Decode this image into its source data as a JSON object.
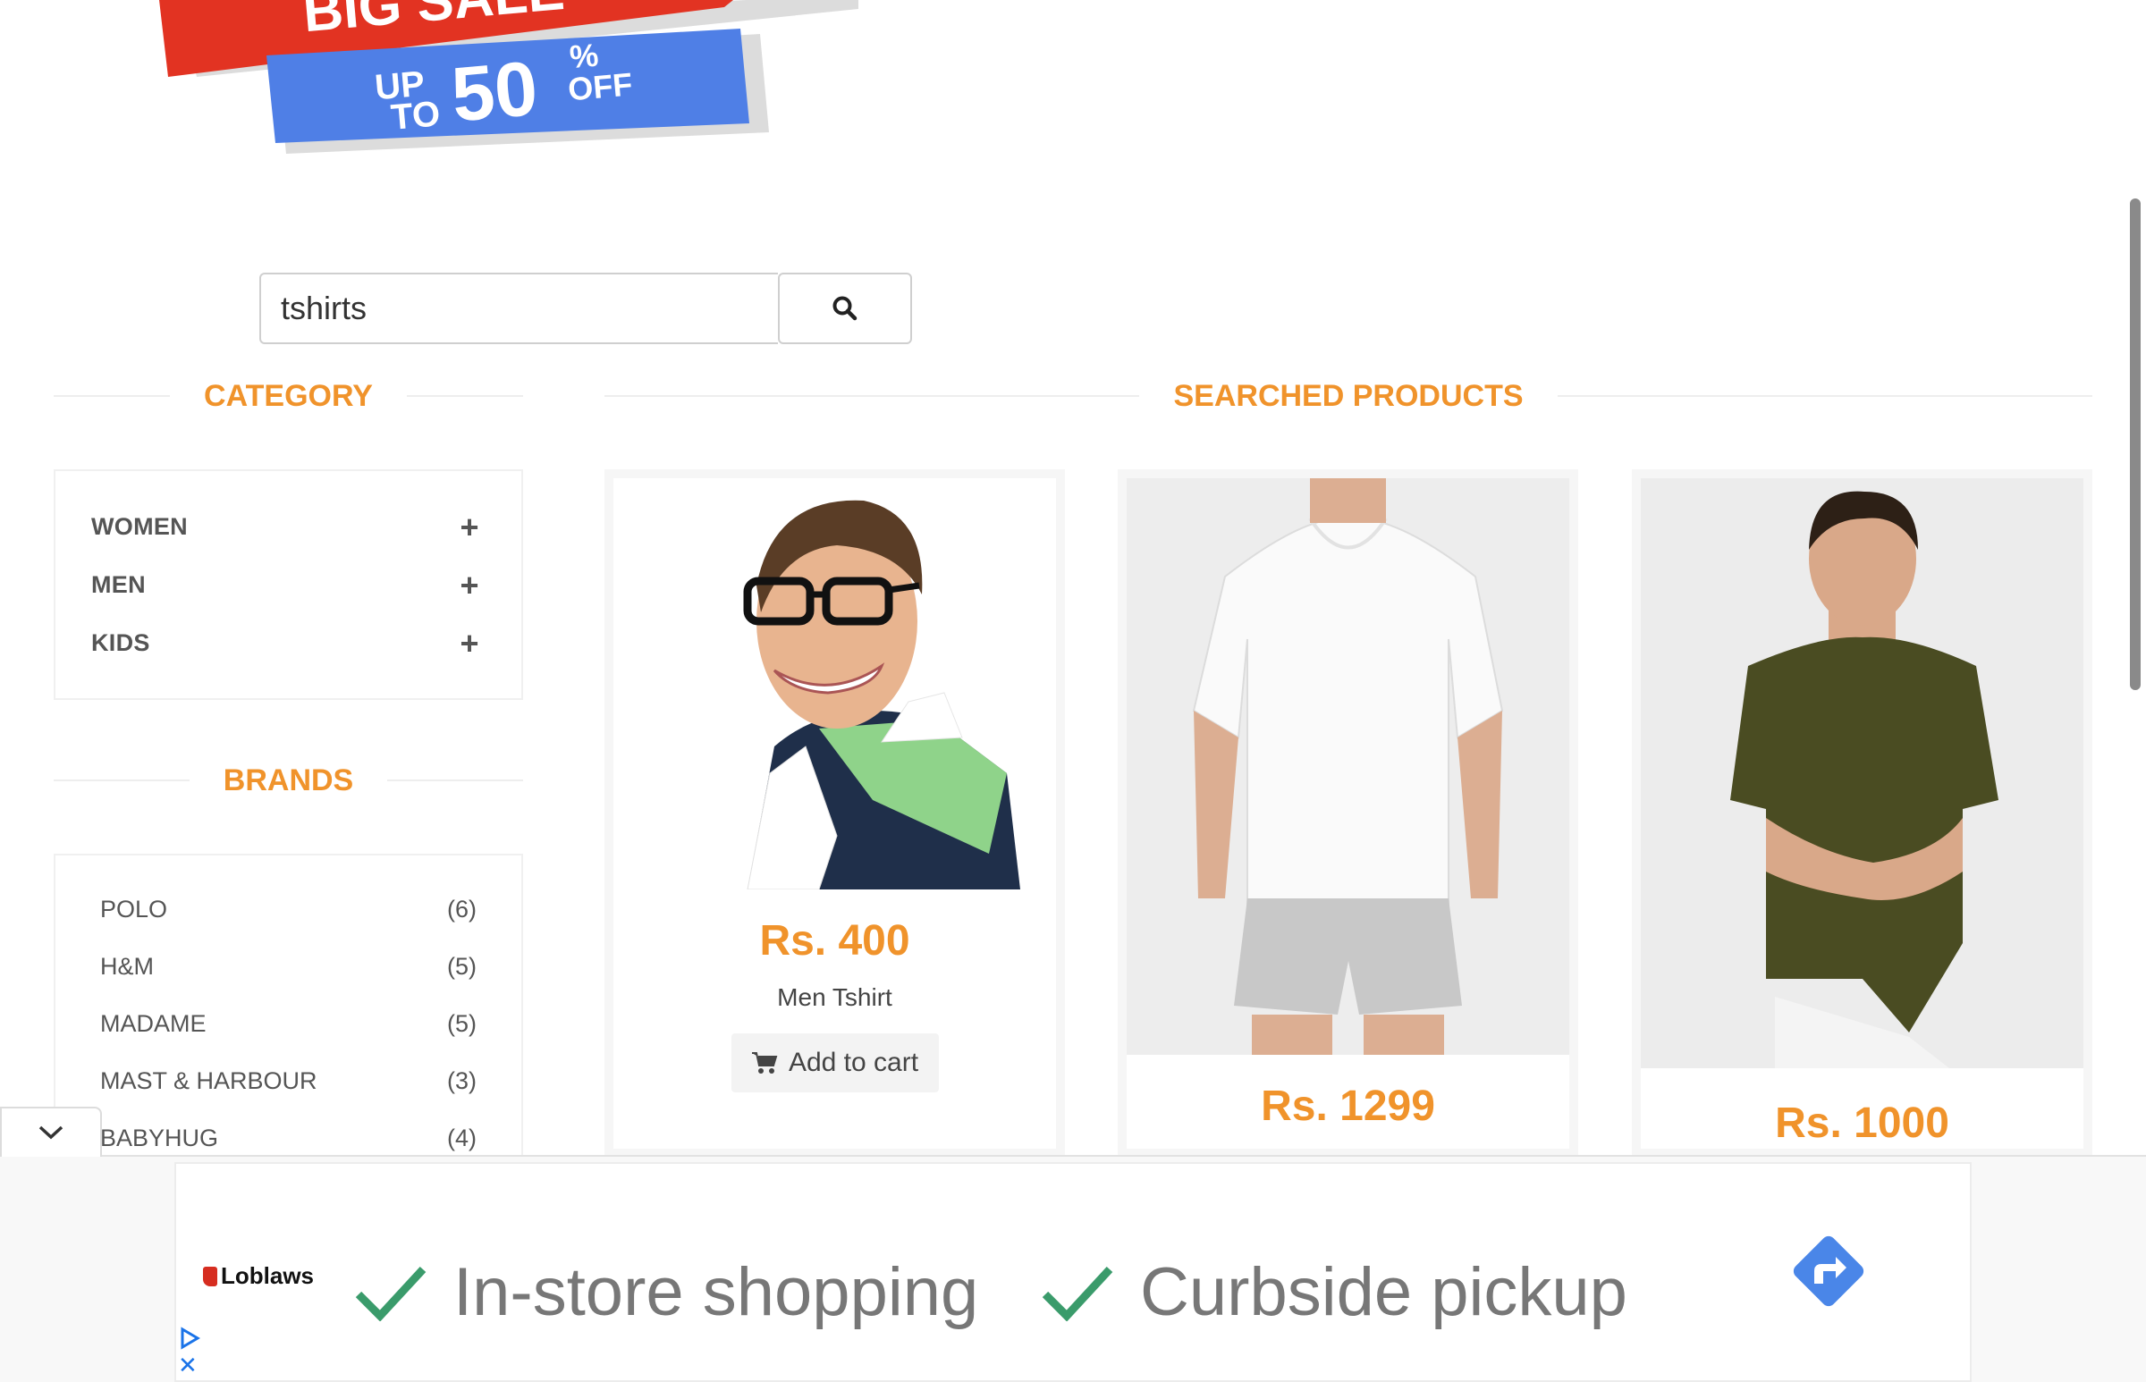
{
  "banner": {
    "headline": "BIG SALE",
    "up": "UP",
    "to": "TO",
    "percent_value": "50",
    "percent_sign": "%",
    "off": "OFF"
  },
  "search": {
    "value": "tshirts",
    "button_icon": "search-icon"
  },
  "category": {
    "title": "CATEGORY",
    "items": [
      {
        "label": "WOMEN",
        "icon": "plus-icon"
      },
      {
        "label": "MEN",
        "icon": "plus-icon"
      },
      {
        "label": "KIDS",
        "icon": "plus-icon"
      }
    ]
  },
  "brands": {
    "title": "BRANDS",
    "items": [
      {
        "label": "POLO",
        "count": "(6)"
      },
      {
        "label": "H&M",
        "count": "(5)"
      },
      {
        "label": "MADAME",
        "count": "(5)"
      },
      {
        "label": "MAST & HARBOUR",
        "count": "(3)"
      },
      {
        "label": "BABYHUG",
        "count": "(4)"
      }
    ]
  },
  "products": {
    "title": "SEARCHED PRODUCTS",
    "items": [
      {
        "price": "Rs. 400",
        "name": "Men Tshirt",
        "cart_label": "Add to cart"
      },
      {
        "price": "Rs. 1299"
      },
      {
        "price": "Rs. 1000"
      }
    ]
  },
  "ad": {
    "brand": "Loblaws",
    "features": [
      "In-store shopping",
      "Curbside pickup"
    ],
    "close_glyph": "✕"
  },
  "colors": {
    "accent": "#f0932b",
    "banner_red": "#e23322",
    "banner_blue": "#4f7fe6",
    "check_green": "#3a9b6b",
    "ad_button_blue": "#4a86e8"
  }
}
